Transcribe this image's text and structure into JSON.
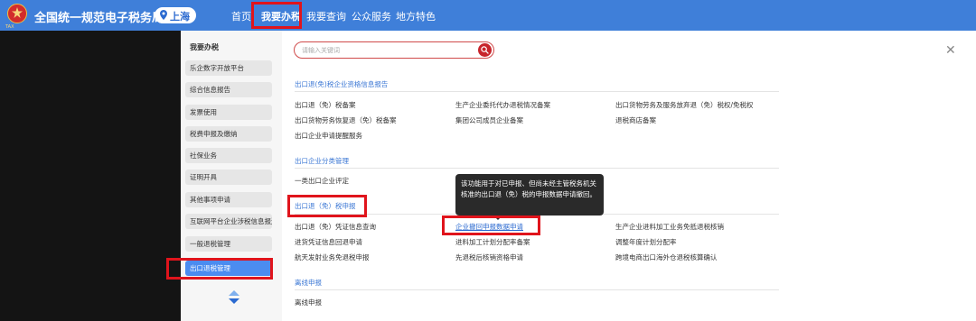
{
  "header": {
    "site_title": "全国统一规范电子税务局",
    "logo_sub": "TAX",
    "region": "上海",
    "nav": [
      "首页",
      "我要办税",
      "我要查询",
      "公众服务",
      "地方特色"
    ]
  },
  "sidebar": {
    "title": "我要办税",
    "items": [
      "乐企数字开放平台",
      "综合信息报告",
      "发票使用",
      "税费申报及缴纳",
      "社保业务",
      "证明开具",
      "其他事项申请",
      "互联网平台企业涉税信息报送",
      "一般退税管理",
      "出口退税管理"
    ]
  },
  "search": {
    "placeholder": "请输入关键词"
  },
  "sections": [
    {
      "title": "出口退(免)税企业资格信息报告",
      "links": [
        "出口退（免）税备案",
        "生产企业委托代办退税情况备案",
        "出口货物劳务及服务放弃退（免）税权/免税权",
        "出口货物劳务恢复退（免）税备案",
        "集团公司成员企业备案",
        "退税商店备案",
        "出口企业申请提醒服务"
      ]
    },
    {
      "title": "出口企业分类管理",
      "links": [
        "一类出口企业评定"
      ]
    },
    {
      "title": "出口退（免）税申报",
      "links": [
        "出口退（免）凭证信息查询",
        "企业撤回申报数据申请",
        "生产企业进料加工业务免抵退税核销",
        "进货凭证信息回退申请",
        "进料加工计划分配率备案",
        "调整年度计划分配率",
        "航天发射业务免退税申报",
        "先退税后核销资格申请",
        "跨境电商出口海外仓退税核算确认"
      ]
    },
    {
      "title": "离线申报",
      "links": [
        "离线申报"
      ]
    }
  ],
  "tooltip": "该功能用于对已申报、但尚未经主管税务机关核准的出口退（免）税的申报数据申请撤回。",
  "colors": {
    "header_bg": "#3f7fd9",
    "accent_red": "#e0141c",
    "link_blue": "#3b77d4",
    "active_item": "#4b8cf0",
    "backdrop": "#141414"
  }
}
